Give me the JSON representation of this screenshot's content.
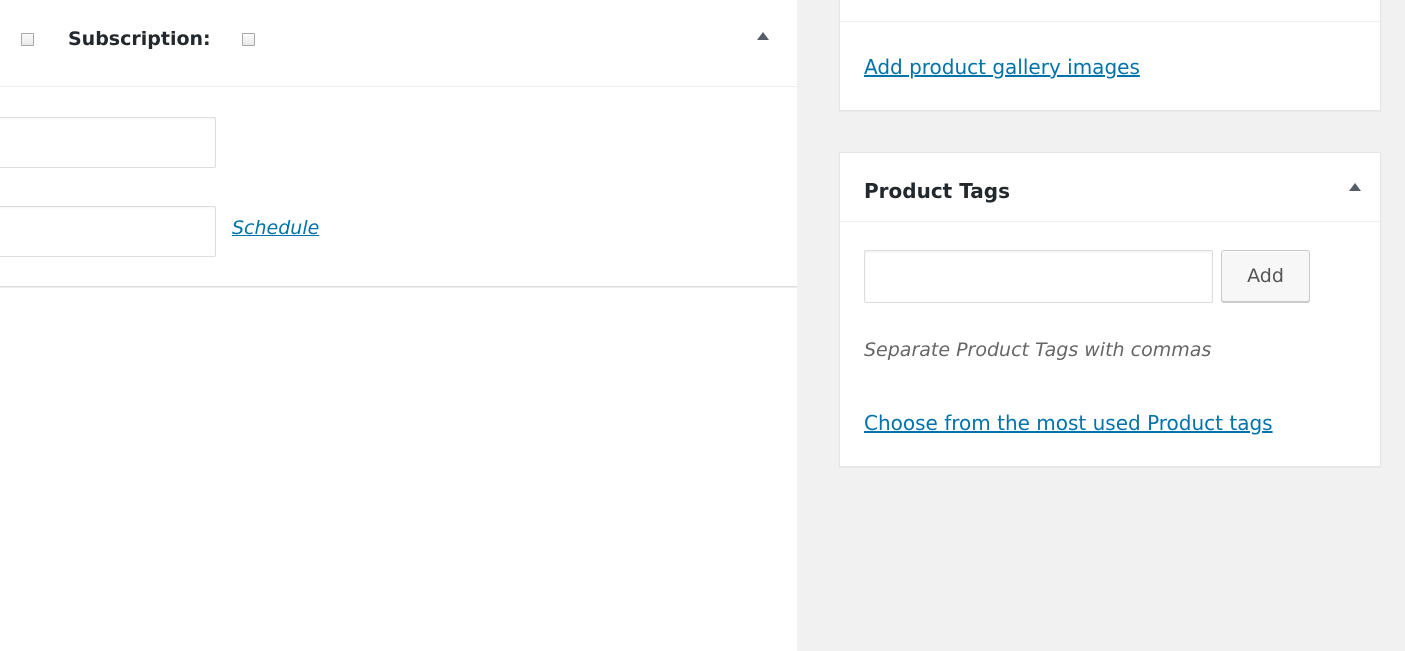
{
  "product_data": {
    "virtual_checked": false,
    "subscription_label": "Subscription:",
    "subscription_checked": false,
    "collapse_icon": "triangle-up-icon",
    "field_1_value": "",
    "field_2_value": "",
    "schedule_link": "Schedule"
  },
  "product_gallery": {
    "add_link": "Add product gallery images"
  },
  "product_tags": {
    "title": "Product Tags",
    "collapse_icon": "triangle-up-icon",
    "input_value": "",
    "add_button": "Add",
    "help_text": "Separate Product Tags with commas",
    "most_used_link": "Choose from the most used Product tags"
  },
  "colors": {
    "link": "#0073aa",
    "sidebar_background": "#f1f1f1",
    "panel_background": "#ffffff",
    "heading_text": "#23282d"
  }
}
